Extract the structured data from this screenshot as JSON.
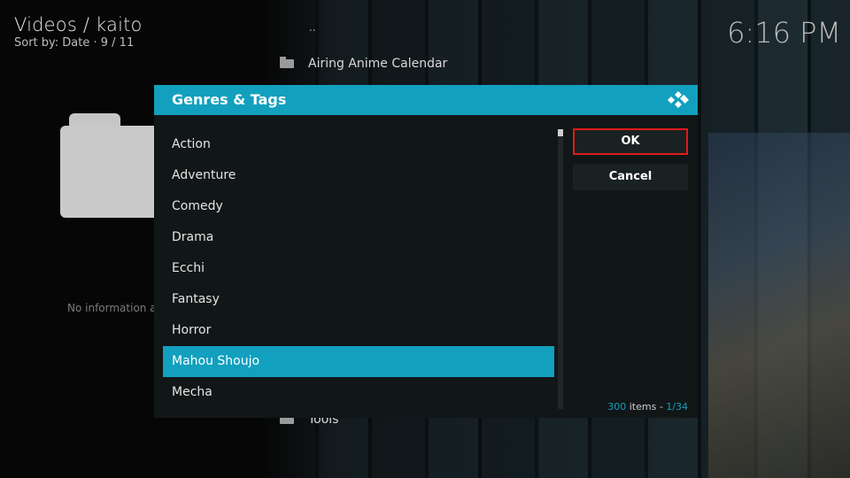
{
  "header": {
    "title": "Videos / kaito",
    "sort_info": "Sort by: Date  ·  9 / 11",
    "clock": "6:16 PM"
  },
  "background": {
    "parent_indicator": "..",
    "items": [
      "Airing Anime Calendar",
      "Tools"
    ],
    "no_info_text": "No information a"
  },
  "dialog": {
    "title": "Genres & Tags",
    "items": [
      {
        "label": "Action",
        "selected": false
      },
      {
        "label": "Adventure",
        "selected": false
      },
      {
        "label": "Comedy",
        "selected": false
      },
      {
        "label": "Drama",
        "selected": false
      },
      {
        "label": "Ecchi",
        "selected": false
      },
      {
        "label": "Fantasy",
        "selected": false
      },
      {
        "label": "Horror",
        "selected": false
      },
      {
        "label": "Mahou Shoujo",
        "selected": true
      },
      {
        "label": "Mecha",
        "selected": false
      }
    ],
    "ok_label": "OK",
    "cancel_label": "Cancel",
    "item_count": {
      "total": "300",
      "items_word": "items",
      "sep": " - ",
      "page": "1/34"
    }
  },
  "colors": {
    "accent": "#12a0be",
    "focus_border": "#e01a1a",
    "dialog_bg": "#111617"
  },
  "icons": {
    "logo": "kodi-logo-icon",
    "folder": "folder-icon"
  }
}
